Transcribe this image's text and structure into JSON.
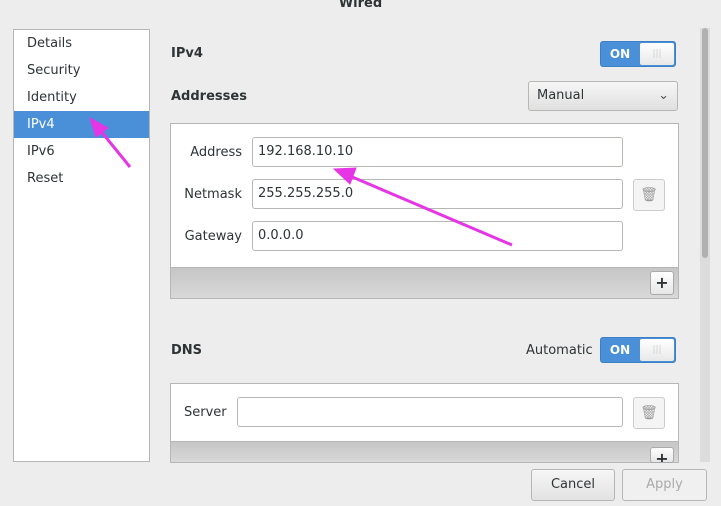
{
  "window": {
    "title": "Wired"
  },
  "sidebar": {
    "items": [
      {
        "label": "Details"
      },
      {
        "label": "Security"
      },
      {
        "label": "Identity"
      },
      {
        "label": "IPv4",
        "selected": true
      },
      {
        "label": "IPv6"
      },
      {
        "label": "Reset"
      }
    ]
  },
  "ipv4": {
    "heading": "IPv4",
    "toggle_label": "ON",
    "toggle_on": true,
    "addresses": {
      "heading": "Addresses",
      "method": "Manual",
      "address_label": "Address",
      "address_value": "192.168.10.10",
      "netmask_label": "Netmask",
      "netmask_value": "255.255.255.0",
      "gateway_label": "Gateway",
      "gateway_value": "0.0.0.0",
      "add_label": "+"
    }
  },
  "dns": {
    "heading": "DNS",
    "automatic_label": "Automatic",
    "toggle_label": "ON",
    "toggle_on": true,
    "server_label": "Server",
    "server_value": "",
    "add_label": "+"
  },
  "footer": {
    "cancel_label": "Cancel",
    "apply_label": "Apply"
  },
  "annotation": {
    "arrow_color": "#e535e5"
  }
}
